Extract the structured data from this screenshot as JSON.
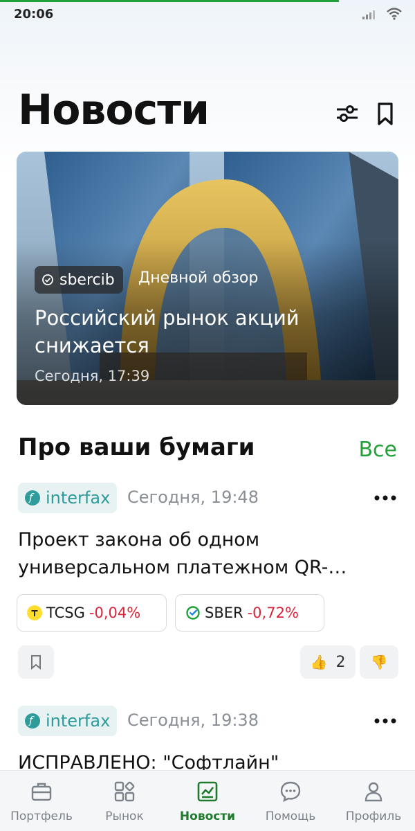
{
  "status_bar": {
    "time": "20:06"
  },
  "header": {
    "title": "Новости"
  },
  "hero": {
    "source": "sbercib",
    "tag": "Дневной обзор",
    "title": "Российский рынок акций снижается",
    "time": "Сегодня, 17:39"
  },
  "section": {
    "title": "Про ваши бумаги",
    "all_label": "Все"
  },
  "news": [
    {
      "source": "interfax",
      "time": "Сегодня, 19:48",
      "title": "Проект закона об одном универсальном платежном QR-…",
      "tickers": [
        {
          "name": "TCSG",
          "change": "-0,04%"
        },
        {
          "name": "SBER",
          "change": "-0,72%"
        }
      ],
      "likes": "2"
    },
    {
      "source": "interfax",
      "time": "Сегодня, 19:38",
      "title": "ИСПРАВЛЕНО: \"Софтлайн\""
    }
  ],
  "bottom_nav": [
    {
      "label": "Портфель",
      "icon": "briefcase-icon"
    },
    {
      "label": "Рынок",
      "icon": "market-grid-icon"
    },
    {
      "label": "Новости",
      "icon": "news-chart-icon",
      "active": true
    },
    {
      "label": "Помощь",
      "icon": "chat-bubble-icon"
    },
    {
      "label": "Профиль",
      "icon": "person-icon"
    }
  ],
  "colors": {
    "accent": "#21a038",
    "negative": "#d9253a",
    "interfax": "#2f9b9a"
  }
}
